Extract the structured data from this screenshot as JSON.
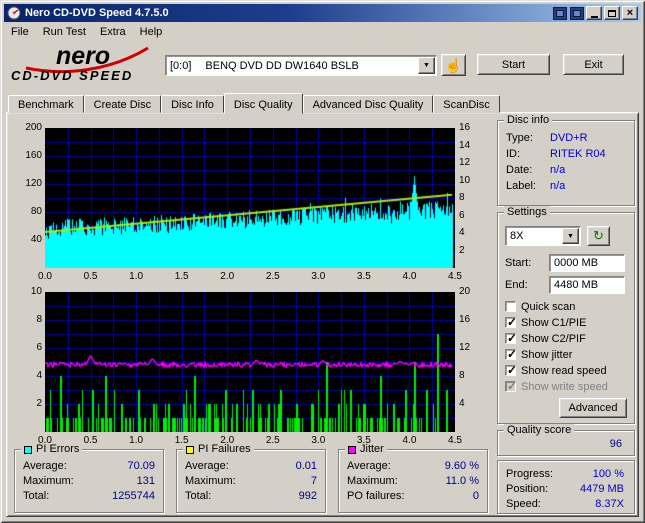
{
  "window": {
    "title": "Nero CD-DVD Speed 4.7.5.0"
  },
  "menu": {
    "items": [
      "File",
      "Run Test",
      "Extra",
      "Help"
    ]
  },
  "logo": {
    "brand": "nero",
    "product": "CD-DVD SPEED"
  },
  "toolbar": {
    "drive_id": "[0:0]",
    "drive_name": "BENQ DVD DD DW1640 BSLB",
    "start_label": "Start",
    "exit_label": "Exit",
    "hand_icon": "select-hand-icon",
    "dropdown_icon": "chevron-down-icon"
  },
  "tabs": [
    "Benchmark",
    "Create Disc",
    "Disc Info",
    "Disc Quality",
    "Advanced Disc Quality",
    "ScanDisc"
  ],
  "active_tab": "Disc Quality",
  "disc_info": {
    "legend": "Disc info",
    "rows": [
      {
        "label": "Type:",
        "value": "DVD+R"
      },
      {
        "label": "ID:",
        "value": "RITEK R04"
      },
      {
        "label": "Date:",
        "value": "n/a"
      },
      {
        "label": "Label:",
        "value": "n/a"
      }
    ]
  },
  "settings": {
    "legend": "Settings",
    "speed": "8X",
    "refresh_icon": "refresh-icon",
    "start_label": "Start:",
    "start_value": "0000 MB",
    "end_label": "End:",
    "end_value": "4480 MB",
    "checkboxes": [
      {
        "label": "Quick scan",
        "checked": false,
        "enabled": true
      },
      {
        "label": "Show C1/PIE",
        "checked": true,
        "enabled": true
      },
      {
        "label": "Show C2/PIF",
        "checked": true,
        "enabled": true
      },
      {
        "label": "Show jitter",
        "checked": true,
        "enabled": true
      },
      {
        "label": "Show read speed",
        "checked": true,
        "enabled": true
      },
      {
        "label": "Show write speed",
        "checked": true,
        "enabled": false
      }
    ],
    "advanced_label": "Advanced"
  },
  "quality": {
    "legend": "Quality score",
    "value": "96"
  },
  "progress": {
    "rows": [
      {
        "label": "Progress:",
        "value": "100 %"
      },
      {
        "label": "Position:",
        "value": "4479 MB"
      },
      {
        "label": "Speed:",
        "value": "8.37X"
      }
    ]
  },
  "stats": {
    "pi_errors": {
      "legend": "PI Errors",
      "color": "#00ffff",
      "rows": [
        {
          "label": "Average:",
          "value": "70.09"
        },
        {
          "label": "Maximum:",
          "value": "131"
        },
        {
          "label": "Total:",
          "value": "1255744"
        }
      ]
    },
    "pi_failures": {
      "legend": "PI Failures",
      "color": "#ffff00",
      "rows": [
        {
          "label": "Average:",
          "value": "0.01"
        },
        {
          "label": "Maximum:",
          "value": "7"
        },
        {
          "label": "Total:",
          "value": "992"
        }
      ]
    },
    "jitter": {
      "legend": "Jitter",
      "color": "#ff00ff",
      "rows": [
        {
          "label": "Average:",
          "value": "9.60 %"
        },
        {
          "label": "Maximum:",
          "value": "11.0 %"
        },
        {
          "label": "PO failures:",
          "value": "0"
        }
      ]
    }
  },
  "chart_data": [
    {
      "type": "area",
      "name": "PI Errors and read speed vs position (GB)",
      "x_range": [
        0,
        4.5
      ],
      "x_ticks": [
        "0.0",
        "0.5",
        "1.0",
        "1.5",
        "2.0",
        "2.5",
        "3.0",
        "3.5",
        "4.0",
        "4.5"
      ],
      "data_end_x": 4.47,
      "left_axis": {
        "name": "PI Errors",
        "range": [
          0,
          200
        ],
        "ticks": [
          200,
          160,
          120,
          80,
          40
        ]
      },
      "right_axis": {
        "name": "Read speed (X)",
        "range": [
          0,
          16
        ],
        "ticks": [
          16,
          14,
          12,
          10,
          8,
          6,
          4,
          2
        ]
      },
      "grid": {
        "color": "#0000aa",
        "x_step": 0.25,
        "left_step": 20
      },
      "series": [
        {
          "name": "PI Errors",
          "style": "area",
          "color": "#00ffff",
          "average": 70.09,
          "maximum": 131,
          "start_level": 55,
          "end_level": 85,
          "spike_x": 4.05
        },
        {
          "name": "Read speed",
          "style": "line",
          "color": "#b4e600",
          "start_value": 4.1,
          "end_value": 8.37
        }
      ]
    },
    {
      "type": "spikes",
      "name": "PI Failures and jitter vs position (GB)",
      "x_range": [
        0,
        4.5
      ],
      "x_ticks": [
        "0.0",
        "0.5",
        "1.0",
        "1.5",
        "2.0",
        "2.5",
        "3.0",
        "3.5",
        "4.0",
        "4.5"
      ],
      "data_end_x": 4.47,
      "left_axis": {
        "name": "PI Failures",
        "range": [
          0,
          10
        ],
        "ticks": [
          10,
          8,
          6,
          4,
          2
        ]
      },
      "right_axis": {
        "name": "Jitter (%)",
        "range": [
          0,
          20
        ],
        "ticks": [
          20,
          16,
          12,
          8,
          4
        ]
      },
      "grid": {
        "color": "#0000aa",
        "x_step": 0.25,
        "left_step": 1
      },
      "series": [
        {
          "name": "PI Failures",
          "style": "spikes",
          "color": "#00ee00",
          "average": 0.01,
          "maximum": 7,
          "spikes": [
            [
              0.16,
              4
            ],
            [
              0.36,
              2
            ],
            [
              0.52,
              3
            ],
            [
              0.66,
              4
            ],
            [
              0.83,
              2
            ],
            [
              1.02,
              3
            ],
            [
              1.18,
              2
            ],
            [
              1.35,
              2
            ],
            [
              1.52,
              2
            ],
            [
              1.64,
              4
            ],
            [
              1.8,
              2
            ],
            [
              1.98,
              3
            ],
            [
              2.1,
              2
            ],
            [
              2.27,
              3
            ],
            [
              2.45,
              2
            ],
            [
              2.58,
              3
            ],
            [
              2.75,
              2
            ],
            [
              2.92,
              2
            ],
            [
              3.08,
              5
            ],
            [
              3.22,
              2
            ],
            [
              3.35,
              3
            ],
            [
              3.5,
              2
            ],
            [
              3.68,
              4
            ],
            [
              3.82,
              2
            ],
            [
              3.95,
              3
            ],
            [
              4.05,
              5
            ],
            [
              4.18,
              3
            ],
            [
              4.3,
              7
            ],
            [
              4.4,
              3
            ]
          ]
        },
        {
          "name": "Jitter",
          "style": "line",
          "color": "#ff00ff",
          "average": 9.6,
          "maximum": 11.0,
          "bumps": [
            [
              0.5,
              11.0
            ],
            [
              1.18,
              10.5
            ],
            [
              2.32,
              10.3
            ],
            [
              3.05,
              10.2
            ],
            [
              3.9,
              10.1
            ]
          ]
        }
      ]
    }
  ]
}
